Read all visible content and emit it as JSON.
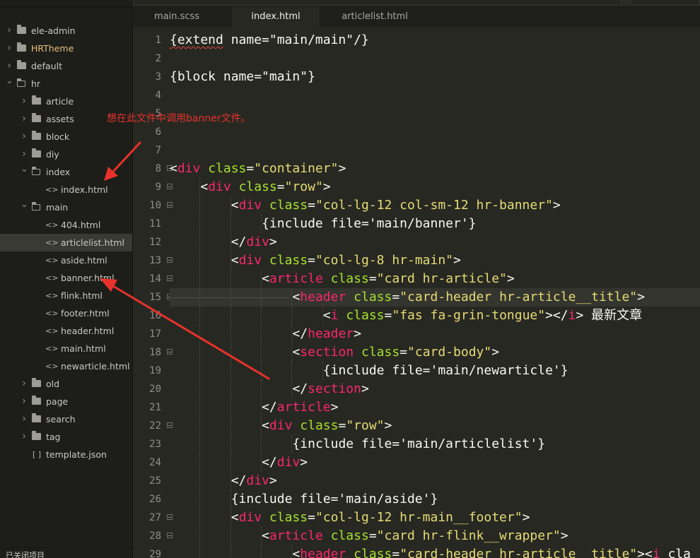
{
  "tabs": [
    {
      "label": "main.scss",
      "active": false
    },
    {
      "label": "index.html",
      "active": true
    },
    {
      "label": "articlelist.html",
      "active": false
    }
  ],
  "sidebar": {
    "items": [
      {
        "label": "ele-admin",
        "type": "folder",
        "depth": 0,
        "expanded": false
      },
      {
        "label": "HRTheme",
        "type": "folder",
        "depth": 0,
        "expanded": false,
        "highlighted": true
      },
      {
        "label": "default",
        "type": "folder",
        "depth": 0,
        "expanded": false
      },
      {
        "label": "hr",
        "type": "folder",
        "depth": 0,
        "expanded": true
      },
      {
        "label": "article",
        "type": "folder",
        "depth": 1,
        "expanded": false
      },
      {
        "label": "assets",
        "type": "folder",
        "depth": 1,
        "expanded": false
      },
      {
        "label": "block",
        "type": "folder",
        "depth": 1,
        "expanded": false
      },
      {
        "label": "diy",
        "type": "folder",
        "depth": 1,
        "expanded": false
      },
      {
        "label": "index",
        "type": "folder",
        "depth": 1,
        "expanded": true
      },
      {
        "label": "index.html",
        "type": "file",
        "depth": 2
      },
      {
        "label": "main",
        "type": "folder",
        "depth": 1,
        "expanded": true
      },
      {
        "label": "404.html",
        "type": "file",
        "depth": 2
      },
      {
        "label": "articlelist.html",
        "type": "file",
        "depth": 2,
        "selected": true
      },
      {
        "label": "aside.html",
        "type": "file",
        "depth": 2
      },
      {
        "label": "banner.html",
        "type": "file",
        "depth": 2
      },
      {
        "label": "flink.html",
        "type": "file",
        "depth": 2
      },
      {
        "label": "footer.html",
        "type": "file",
        "depth": 2
      },
      {
        "label": "header.html",
        "type": "file",
        "depth": 2
      },
      {
        "label": "main.html",
        "type": "file",
        "depth": 2
      },
      {
        "label": "newarticle.html",
        "type": "file",
        "depth": 2
      },
      {
        "label": "old",
        "type": "folder",
        "depth": 1,
        "expanded": false
      },
      {
        "label": "page",
        "type": "folder",
        "depth": 1,
        "expanded": false
      },
      {
        "label": "search",
        "type": "folder",
        "depth": 1,
        "expanded": false
      },
      {
        "label": "tag",
        "type": "folder",
        "depth": 1,
        "expanded": false
      },
      {
        "label": "template.json",
        "type": "json",
        "depth": 1
      }
    ],
    "bottom_label": "已关闭项目"
  },
  "icons": {
    "folder_closed": "folder-icon",
    "folder_open": "folder-open-icon",
    "file_html": "code-file-icon",
    "file_json": "json-file-icon",
    "collapsed": "chevron-right-icon",
    "expanded": "chevron-down-icon"
  },
  "annotation": {
    "text": "想在此文件中调用banner文件。",
    "color": "#e8322b"
  },
  "editor": {
    "current_line": 15,
    "lines": [
      {
        "n": 1,
        "fold": false,
        "indent": 0,
        "tokens": [
          [
            "p",
            "{extend name=\"main/main\"/}"
          ]
        ]
      },
      {
        "n": 2,
        "fold": false,
        "indent": 0,
        "tokens": []
      },
      {
        "n": 3,
        "fold": false,
        "indent": 0,
        "tokens": [
          [
            "p",
            "{block name=\"main\"}"
          ]
        ]
      },
      {
        "n": 4,
        "fold": false,
        "indent": 0,
        "tokens": []
      },
      {
        "n": 5,
        "fold": false,
        "indent": 0,
        "tokens": []
      },
      {
        "n": 6,
        "fold": false,
        "indent": 0,
        "tokens": []
      },
      {
        "n": 7,
        "fold": false,
        "indent": 0,
        "tokens": []
      },
      {
        "n": 8,
        "fold": true,
        "indent": 0,
        "tokens": [
          [
            "p",
            "<"
          ],
          [
            "t",
            "div"
          ],
          [
            "p",
            " "
          ],
          [
            "a",
            "class"
          ],
          [
            "p",
            "="
          ],
          [
            "s",
            "\"container\""
          ],
          [
            "p",
            ">"
          ]
        ]
      },
      {
        "n": 9,
        "fold": true,
        "indent": 1,
        "tokens": [
          [
            "p",
            "<"
          ],
          [
            "t",
            "div"
          ],
          [
            "p",
            " "
          ],
          [
            "a",
            "class"
          ],
          [
            "p",
            "="
          ],
          [
            "s",
            "\"row\""
          ],
          [
            "p",
            ">"
          ]
        ]
      },
      {
        "n": 10,
        "fold": true,
        "indent": 2,
        "tokens": [
          [
            "p",
            "<"
          ],
          [
            "t",
            "div"
          ],
          [
            "p",
            " "
          ],
          [
            "a",
            "class"
          ],
          [
            "p",
            "="
          ],
          [
            "s",
            "\"col-lg-12 col-sm-12 hr-banner\""
          ],
          [
            "p",
            ">"
          ]
        ]
      },
      {
        "n": 11,
        "fold": false,
        "indent": 3,
        "tokens": [
          [
            "p",
            "{include file='main/banner'}"
          ]
        ]
      },
      {
        "n": 12,
        "fold": false,
        "indent": 2,
        "tokens": [
          [
            "p",
            "</"
          ],
          [
            "t",
            "div"
          ],
          [
            "p",
            ">"
          ]
        ]
      },
      {
        "n": 13,
        "fold": true,
        "indent": 2,
        "tokens": [
          [
            "p",
            "<"
          ],
          [
            "t",
            "div"
          ],
          [
            "p",
            " "
          ],
          [
            "a",
            "class"
          ],
          [
            "p",
            "="
          ],
          [
            "s",
            "\"col-lg-8 hr-main\""
          ],
          [
            "p",
            ">"
          ]
        ]
      },
      {
        "n": 14,
        "fold": true,
        "indent": 3,
        "tokens": [
          [
            "p",
            "<"
          ],
          [
            "t",
            "article"
          ],
          [
            "p",
            " "
          ],
          [
            "a",
            "class"
          ],
          [
            "p",
            "="
          ],
          [
            "s",
            "\"card hr-article\""
          ],
          [
            "p",
            ">"
          ]
        ]
      },
      {
        "n": 15,
        "fold": true,
        "indent": 4,
        "tokens": [
          [
            "p",
            "<"
          ],
          [
            "t",
            "header"
          ],
          [
            "p",
            " "
          ],
          [
            "a",
            "class"
          ],
          [
            "p",
            "="
          ],
          [
            "s",
            "\"card-header hr-article__title\""
          ],
          [
            "p",
            ">"
          ]
        ]
      },
      {
        "n": 16,
        "fold": false,
        "indent": 5,
        "tokens": [
          [
            "p",
            "<"
          ],
          [
            "t",
            "i"
          ],
          [
            "p",
            " "
          ],
          [
            "a",
            "class"
          ],
          [
            "p",
            "="
          ],
          [
            "s",
            "\"fas fa-grin-tongue\""
          ],
          [
            "p",
            "></"
          ],
          [
            "t",
            "i"
          ],
          [
            "p",
            "> 最新文章"
          ]
        ]
      },
      {
        "n": 17,
        "fold": false,
        "indent": 4,
        "tokens": [
          [
            "p",
            "</"
          ],
          [
            "t",
            "header"
          ],
          [
            "p",
            ">"
          ]
        ]
      },
      {
        "n": 18,
        "fold": true,
        "indent": 4,
        "tokens": [
          [
            "p",
            "<"
          ],
          [
            "t",
            "section"
          ],
          [
            "p",
            " "
          ],
          [
            "a",
            "class"
          ],
          [
            "p",
            "="
          ],
          [
            "s",
            "\"card-body\""
          ],
          [
            "p",
            ">"
          ]
        ]
      },
      {
        "n": 19,
        "fold": false,
        "indent": 5,
        "tokens": [
          [
            "p",
            "{include file='main/newarticle'}"
          ]
        ]
      },
      {
        "n": 20,
        "fold": false,
        "indent": 4,
        "tokens": [
          [
            "p",
            "</"
          ],
          [
            "t",
            "section"
          ],
          [
            "p",
            ">"
          ]
        ]
      },
      {
        "n": 21,
        "fold": false,
        "indent": 3,
        "tokens": [
          [
            "p",
            "</"
          ],
          [
            "t",
            "article"
          ],
          [
            "p",
            ">"
          ]
        ]
      },
      {
        "n": 22,
        "fold": true,
        "indent": 3,
        "tokens": [
          [
            "p",
            "<"
          ],
          [
            "t",
            "div"
          ],
          [
            "p",
            " "
          ],
          [
            "a",
            "class"
          ],
          [
            "p",
            "="
          ],
          [
            "s",
            "\"row\""
          ],
          [
            "p",
            ">"
          ]
        ]
      },
      {
        "n": 23,
        "fold": false,
        "indent": 4,
        "tokens": [
          [
            "p",
            "{include file='main/articlelist'}"
          ]
        ]
      },
      {
        "n": 24,
        "fold": false,
        "indent": 3,
        "tokens": [
          [
            "p",
            "</"
          ],
          [
            "t",
            "div"
          ],
          [
            "p",
            ">"
          ]
        ]
      },
      {
        "n": 25,
        "fold": false,
        "indent": 2,
        "tokens": [
          [
            "p",
            "</"
          ],
          [
            "t",
            "div"
          ],
          [
            "p",
            ">"
          ]
        ]
      },
      {
        "n": 26,
        "fold": false,
        "indent": 2,
        "tokens": [
          [
            "p",
            "{include file='main/aside'}"
          ]
        ]
      },
      {
        "n": 27,
        "fold": true,
        "indent": 2,
        "tokens": [
          [
            "p",
            "<"
          ],
          [
            "t",
            "div"
          ],
          [
            "p",
            " "
          ],
          [
            "a",
            "class"
          ],
          [
            "p",
            "="
          ],
          [
            "s",
            "\"col-lg-12 hr-main__footer\""
          ],
          [
            "p",
            ">"
          ]
        ]
      },
      {
        "n": 28,
        "fold": true,
        "indent": 3,
        "tokens": [
          [
            "p",
            "<"
          ],
          [
            "t",
            "article"
          ],
          [
            "p",
            " "
          ],
          [
            "a",
            "class"
          ],
          [
            "p",
            "="
          ],
          [
            "s",
            "\"card hr-flink__wrapper\""
          ],
          [
            "p",
            ">"
          ]
        ]
      },
      {
        "n": 29,
        "fold": false,
        "indent": 4,
        "tokens": [
          [
            "p",
            "<"
          ],
          [
            "t",
            "header"
          ],
          [
            "p",
            " "
          ],
          [
            "a",
            "class"
          ],
          [
            "p",
            "="
          ],
          [
            "s",
            "\"card-header hr-article__title\""
          ],
          [
            "p",
            "><"
          ],
          [
            "t",
            "i"
          ],
          [
            "p",
            " cla"
          ]
        ]
      }
    ]
  },
  "colors": {
    "background": "#272822",
    "tag": "#f92672",
    "attribute": "#a6e22e",
    "string": "#e6db74",
    "text": "#f8f8f2",
    "line_number": "#8f908a"
  }
}
